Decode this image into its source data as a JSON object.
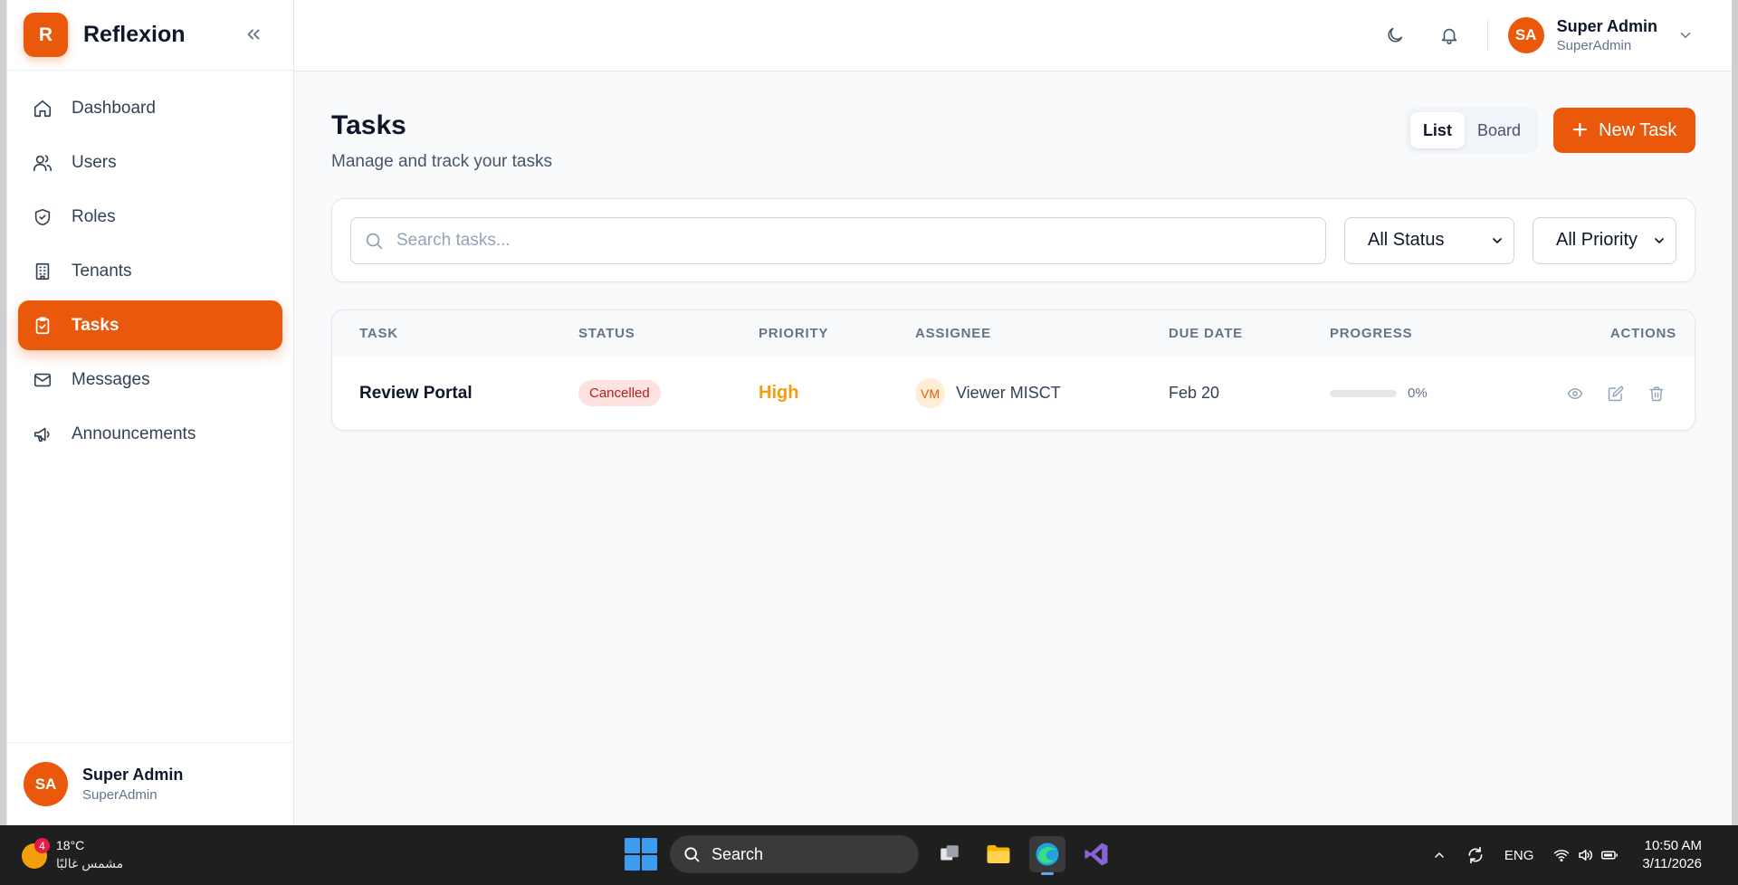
{
  "app": {
    "name": "Reflexion",
    "logo_letter": "R"
  },
  "sidebar": {
    "items": [
      {
        "label": "Dashboard",
        "icon": "home-icon"
      },
      {
        "label": "Users",
        "icon": "users-icon"
      },
      {
        "label": "Roles",
        "icon": "shield-icon"
      },
      {
        "label": "Tenants",
        "icon": "building-icon"
      },
      {
        "label": "Tasks",
        "icon": "clipboard-check-icon",
        "active": true
      },
      {
        "label": "Messages",
        "icon": "mail-icon"
      },
      {
        "label": "Announcements",
        "icon": "megaphone-icon"
      }
    ],
    "user": {
      "initials": "SA",
      "name": "Super Admin",
      "role": "SuperAdmin"
    }
  },
  "topbar": {
    "user": {
      "initials": "SA",
      "name": "Super Admin",
      "role": "SuperAdmin"
    }
  },
  "page": {
    "title": "Tasks",
    "subtitle": "Manage and track your tasks",
    "view_toggle": {
      "list": "List",
      "board": "Board",
      "selected": "List"
    },
    "new_task_label": "New Task"
  },
  "filters": {
    "search_placeholder": "Search tasks...",
    "status_value": "All Status",
    "priority_value": "All Priority"
  },
  "table": {
    "headers": {
      "task": "TASK",
      "status": "STATUS",
      "priority": "PRIORITY",
      "assignee": "ASSIGNEE",
      "due_date": "DUE DATE",
      "progress": "PROGRESS",
      "actions": "ACTIONS"
    },
    "rows": [
      {
        "task": "Review Portal",
        "status": "Cancelled",
        "priority": "High",
        "assignee_initials": "VM",
        "assignee": "Viewer MISCT",
        "due_date": "Feb 20",
        "progress": 0,
        "progress_label": "0%"
      }
    ]
  },
  "colors": {
    "accent": "#ea580c",
    "priority_high": "#f59e0b",
    "status_cancelled_bg": "#fee2e2",
    "status_cancelled_fg": "#b91c1c"
  },
  "taskbar": {
    "weather": {
      "badge": "4",
      "temp": "18°C",
      "desc": "مشمس غالبًا"
    },
    "search_label": "Search",
    "tray": {
      "language": "ENG"
    },
    "clock": {
      "time": "10:50 AM",
      "date": "3/11/2026"
    }
  }
}
